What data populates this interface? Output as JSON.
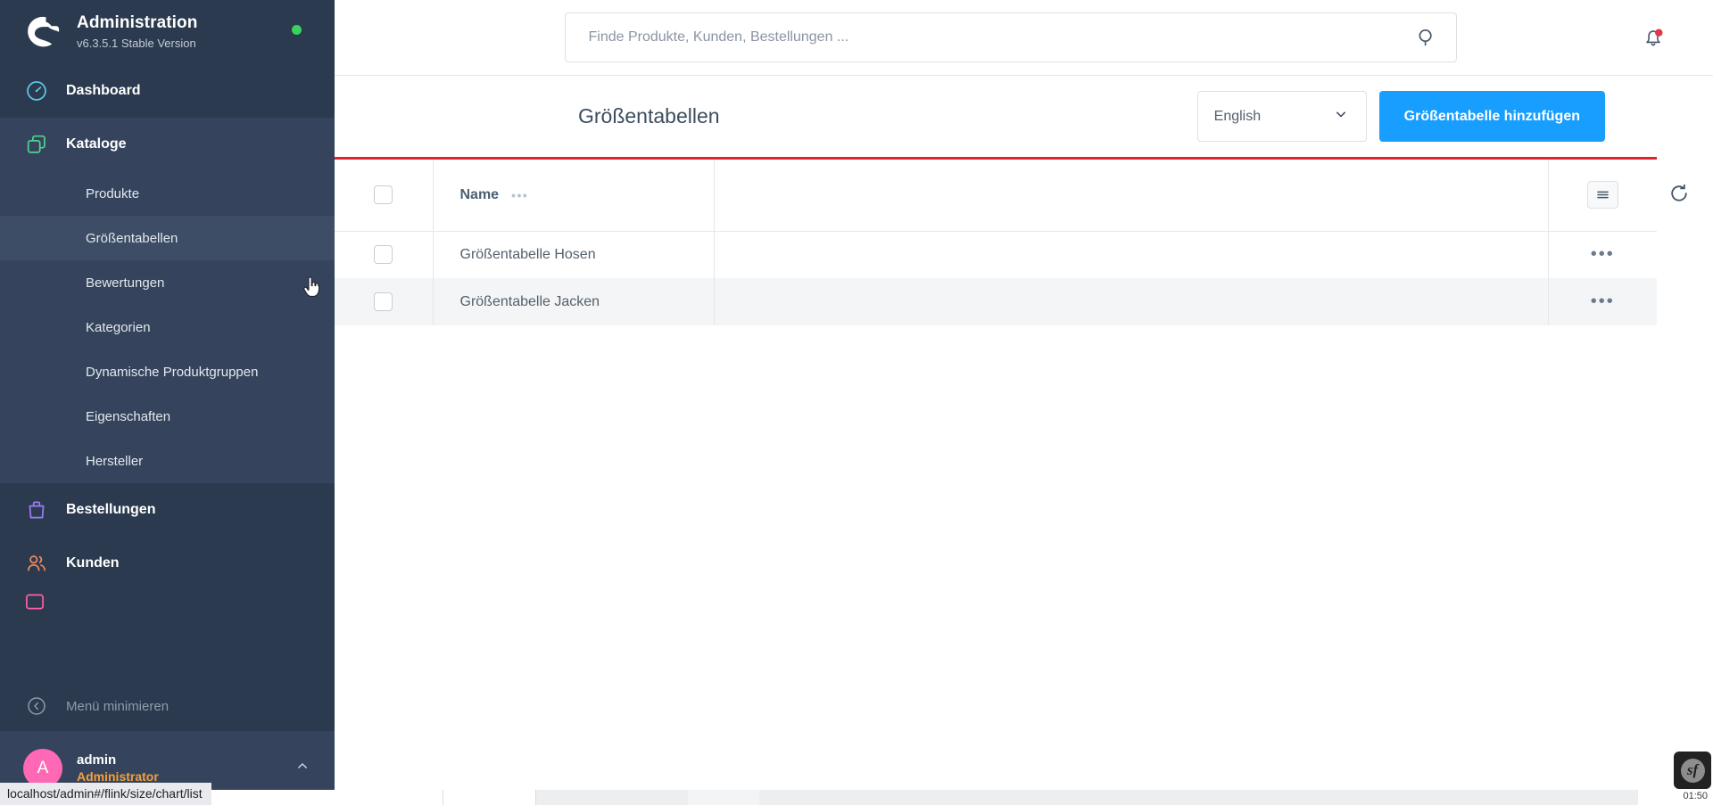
{
  "sidebar": {
    "brand": {
      "title": "Administration",
      "version": "v6.3.5.1 Stable Version",
      "status_color": "#37d35e"
    },
    "nav": [
      {
        "label": "Dashboard",
        "icon": "dashboard-icon",
        "color": "#5ec9e8"
      },
      {
        "label": "Kataloge",
        "icon": "catalog-icon",
        "color": "#4fd292"
      },
      {
        "label": "Bestellungen",
        "icon": "bag-icon",
        "color": "#9a7cf7"
      },
      {
        "label": "Kunden",
        "icon": "users-icon",
        "color": "#f08a5d"
      }
    ],
    "catalog_children": [
      {
        "label": "Produkte",
        "active": false
      },
      {
        "label": "Größentabellen",
        "active": true
      },
      {
        "label": "Bewertungen",
        "active": false
      },
      {
        "label": "Kategorien",
        "active": false
      },
      {
        "label": "Dynamische Produktgruppen",
        "active": false
      },
      {
        "label": "Eigenschaften",
        "active": false
      },
      {
        "label": "Hersteller",
        "active": false
      }
    ],
    "minimize_label": "Menü minimieren",
    "user": {
      "avatar_letter": "A",
      "name": "admin",
      "role": "Administrator",
      "avatar_color": "#ff68b4",
      "role_color": "#f2a03d"
    }
  },
  "status_bar": {
    "url": "localhost/admin#/flink/size/chart/list"
  },
  "topbar": {
    "search_placeholder": "Finde Produkte, Kunden, Bestellungen ...",
    "search_value": "",
    "notification_badge": true,
    "badge_color": "#e3344c"
  },
  "page_header": {
    "title": "Größentabellen",
    "language_selected": "English",
    "add_button_label": "Größentabelle hinzufügen",
    "accent_color": "#189eff"
  },
  "grid": {
    "top_bar_color": "#e1232b",
    "columns": [
      {
        "key": "select",
        "label": ""
      },
      {
        "key": "name",
        "label": "Name"
      },
      {
        "key": "blank",
        "label": ""
      },
      {
        "key": "actions",
        "label": ""
      }
    ],
    "header_dots": "•••",
    "settings_icon": "hamburger-icon",
    "refresh_icon": "refresh-icon",
    "rows": [
      {
        "name": "Größentabelle Hosen",
        "selected": false,
        "context_menu": "•••"
      },
      {
        "name": "Größentabelle Jacken",
        "selected": false,
        "context_menu": "•••"
      }
    ]
  },
  "browser_chrome": {
    "clock": "01:50"
  },
  "debug_toolbar": {
    "label": "sf"
  }
}
